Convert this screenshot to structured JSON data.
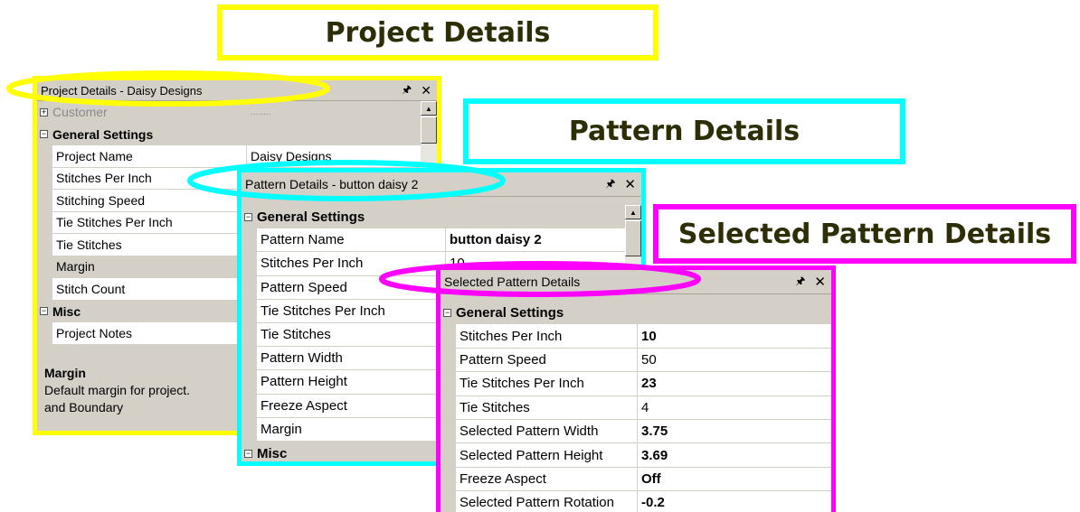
{
  "labels": {
    "project": "Project Details",
    "pattern": "Pattern Details",
    "selected": "Selected Pattern Details"
  },
  "colors": {
    "yellow": "#ffff00",
    "cyan": "#00ffff",
    "magenta": "#ff00ff",
    "label_text": "#2e2e06"
  },
  "project_window": {
    "title": "Project Details - Daisy Designs",
    "rows": [
      {
        "type": "cat",
        "expander": "+",
        "name": "Customer",
        "value": "........",
        "faded": true
      },
      {
        "type": "cat",
        "expander": "−",
        "name": "General Settings"
      },
      {
        "type": "prop",
        "name": "Project Name",
        "value": "Daisy Designs"
      },
      {
        "type": "prop",
        "name": "Stitches Per Inch",
        "value": ""
      },
      {
        "type": "prop",
        "name": "Stitching Speed",
        "value": ""
      },
      {
        "type": "prop",
        "name": "Tie Stitches Per Inch",
        "value": ""
      },
      {
        "type": "prop",
        "name": "Tie Stitches",
        "value": ""
      },
      {
        "type": "prop",
        "name": "Margin",
        "value": "",
        "selected": true
      },
      {
        "type": "prop",
        "name": "Stitch Count",
        "value": ""
      },
      {
        "type": "cat",
        "expander": "−",
        "name": "Misc"
      },
      {
        "type": "prop",
        "name": "Project Notes",
        "value": ""
      }
    ],
    "description_title": "Margin",
    "description_text_1": "Default margin for project.",
    "description_text_2": "and Boundary"
  },
  "pattern_window": {
    "title": "Pattern Details - button daisy 2",
    "rows": [
      {
        "type": "cat",
        "expander": "−",
        "name": "General Settings"
      },
      {
        "type": "prop",
        "name": "Pattern Name",
        "value": "button daisy 2",
        "bold": true
      },
      {
        "type": "prop",
        "name": "Stitches Per Inch",
        "value": "10"
      },
      {
        "type": "prop",
        "name": "Pattern Speed",
        "value": ""
      },
      {
        "type": "prop",
        "name": "Tie Stitches Per Inch",
        "value": ""
      },
      {
        "type": "prop",
        "name": "Tie Stitches",
        "value": ""
      },
      {
        "type": "prop",
        "name": "Pattern Width",
        "value": ""
      },
      {
        "type": "prop",
        "name": "Pattern Height",
        "value": ""
      },
      {
        "type": "prop",
        "name": "Freeze Aspect",
        "value": ""
      },
      {
        "type": "prop",
        "name": "Margin",
        "value": ""
      },
      {
        "type": "cat",
        "expander": "−",
        "name": "Misc"
      }
    ]
  },
  "selected_window": {
    "title": "Selected Pattern Details",
    "rows": [
      {
        "type": "cat",
        "expander": "−",
        "name": "General Settings"
      },
      {
        "type": "prop",
        "name": "Stitches Per Inch",
        "value": "10",
        "bold": true
      },
      {
        "type": "prop",
        "name": "Pattern Speed",
        "value": "50"
      },
      {
        "type": "prop",
        "name": "Tie Stitches Per Inch",
        "value": "23",
        "bold": true
      },
      {
        "type": "prop",
        "name": "Tie Stitches",
        "value": "4"
      },
      {
        "type": "prop",
        "name": "Selected Pattern Width",
        "value": "3.75",
        "bold": true
      },
      {
        "type": "prop",
        "name": "Selected Pattern Height",
        "value": "3.69",
        "bold": true
      },
      {
        "type": "prop",
        "name": "Freeze Aspect",
        "value": "Off",
        "bold": true
      },
      {
        "type": "prop",
        "name": "Selected Pattern Rotation",
        "value": "-0.2",
        "bold": true
      }
    ]
  }
}
